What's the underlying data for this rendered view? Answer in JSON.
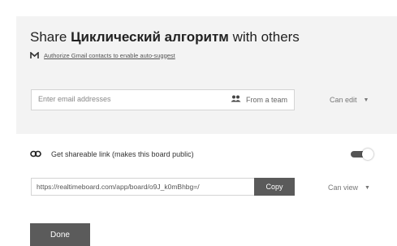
{
  "dialog": {
    "title_prefix": "Share",
    "board_name": "Циклический алгоритм",
    "title_suffix": "with others",
    "gmail_link": "Authorize Gmail contacts to enable auto-suggest"
  },
  "invite": {
    "email_placeholder": "Enter email addresses",
    "team_button": "From a team",
    "permission": "Can edit"
  },
  "share_link": {
    "label": "Get shareable link (makes this board public)",
    "toggle_on": true,
    "url": "https://realtimeboard.com/app/board/o9J_k0mBhbg=/",
    "copy_label": "Copy",
    "permission": "Can view"
  },
  "footer": {
    "done_label": "Done"
  },
  "colors": {
    "panel_bg": "#f3f3f3",
    "button_dark": "#5a5a5a"
  },
  "icons": {
    "gmail": "gmail-icon",
    "team": "team-icon",
    "link": "link-icon",
    "caret": "caret-down-icon"
  }
}
